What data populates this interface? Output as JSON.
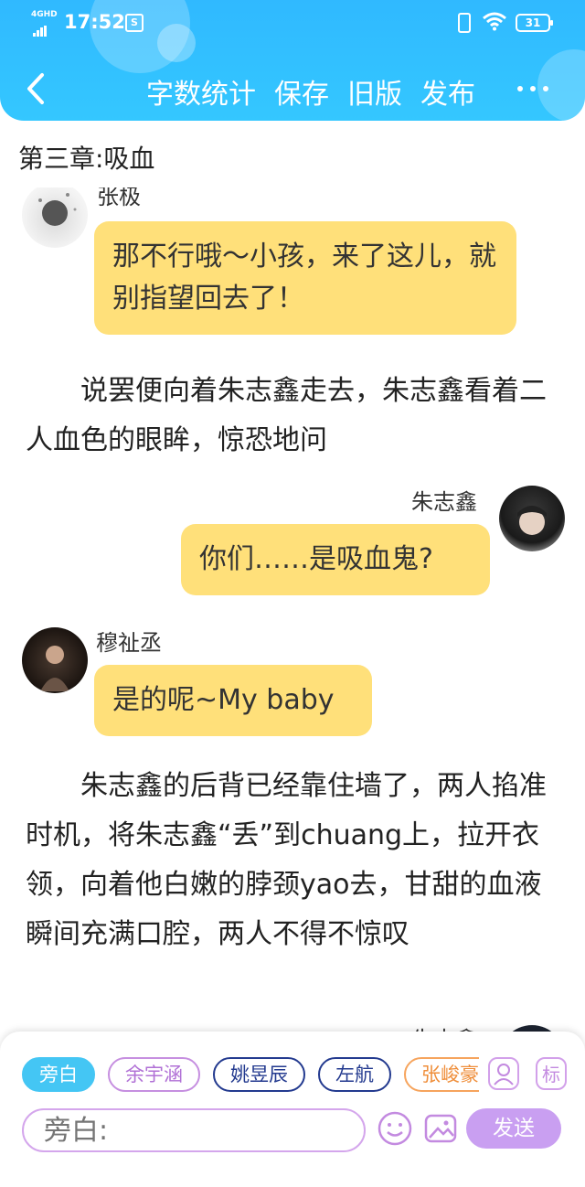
{
  "status_bar": {
    "network": "4GHD",
    "time": "17:52",
    "notification_badge": "S",
    "battery": "31"
  },
  "toolbar": {
    "actions": [
      "字数统计",
      "保存",
      "旧版",
      "发布"
    ]
  },
  "chapter_title": "第三章:吸血",
  "story": {
    "msg1": {
      "speaker": "张极",
      "text": "那不行哦～小孩，来了这儿，就别指望回去了！"
    },
    "narr1": "说罢便向着朱志鑫走去，朱志鑫看着二人血色的眼眸，惊恐地问",
    "msg2": {
      "speaker": "朱志鑫",
      "text": "你们……是吸血鬼?"
    },
    "msg3": {
      "speaker": "穆祉丞",
      "text": "是的呢~My baby"
    },
    "narr2": "朱志鑫的后背已经靠住墙了，两人掐准时机，将朱志鑫“丢”到chuang上，拉开衣领，向着他白嫩的脖颈yao去，甘甜的血液瞬间充满口腔，两人不得不惊叹",
    "msg4": {
      "speaker": "朱志鑫"
    }
  },
  "input_panel": {
    "roles": [
      "旁白",
      "余宇涵",
      "姚昱辰",
      "左航",
      "张峻豪"
    ],
    "active_role": "旁白",
    "side_buttons": {
      "tag": "标"
    },
    "placeholder": "旁白:",
    "send_label": "发送"
  },
  "colors": {
    "header": "#34c7ff",
    "bubble": "#ffe07a",
    "send": "#c99ff1",
    "active_chip": "#44c6f4"
  }
}
